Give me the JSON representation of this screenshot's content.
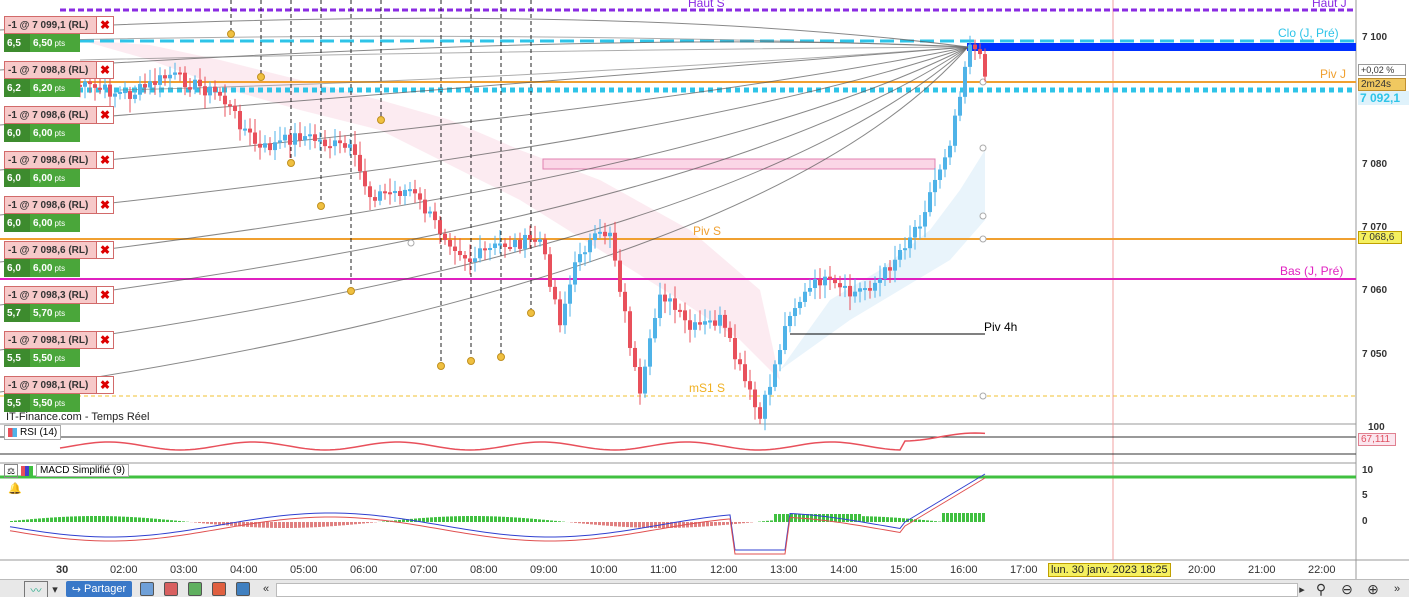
{
  "colors": {
    "up_candle": "#4fb3e8",
    "down_candle": "#e8505b",
    "clo_line": "#2ec4e8",
    "piv_line": "#f0a030",
    "bas_line": "#e020c0",
    "haut_line": "#8a2be2",
    "order_bg": "#f7c9c9",
    "pts_green": "#4aa63a"
  },
  "orders": [
    {
      "label": "-1 @ 7 099,1 (RL)",
      "qty": "6,5",
      "pts": "6,50",
      "unit": "pts"
    },
    {
      "label": "-1 @ 7 098,8 (RL)",
      "qty": "6,2",
      "pts": "6,20",
      "unit": "pts"
    },
    {
      "label": "-1 @ 7 098,6 (RL)",
      "qty": "6,0",
      "pts": "6,00",
      "unit": "pts"
    },
    {
      "label": "-1 @ 7 098,6 (RL)",
      "qty": "6,0",
      "pts": "6,00",
      "unit": "pts"
    },
    {
      "label": "-1 @ 7 098,6 (RL)",
      "qty": "6,0",
      "pts": "6,00",
      "unit": "pts"
    },
    {
      "label": "-1 @ 7 098,6 (RL)",
      "qty": "6,0",
      "pts": "6,00",
      "unit": "pts"
    },
    {
      "label": "-1 @ 7 098,3 (RL)",
      "qty": "5,7",
      "pts": "5,70",
      "unit": "pts"
    },
    {
      "label": "-1 @ 7 098,1 (RL)",
      "qty": "5,5",
      "pts": "5,50",
      "unit": "pts"
    },
    {
      "label": "-1 @ 7 098,1 (RL)",
      "qty": "5,5",
      "pts": "5,50",
      "unit": "pts"
    }
  ],
  "close_symbol": "✖",
  "levels": {
    "haut_s": "Haut S",
    "haut_j": "Haut J",
    "clo": "Clo (J, Pré)",
    "piv_j": "Piv J",
    "piv_s": "Piv S",
    "bas": "Bas (J, Pré)",
    "piv_4h": "Piv 4h",
    "ms1_s": "mS1 S"
  },
  "price_axis": [
    "7 100",
    "7 080",
    "7 070",
    "7 060",
    "7 050"
  ],
  "price_axis_cut": "100",
  "tags": {
    "change": "+0,02 %",
    "timer": "2m24s",
    "last_price": "7 092,1",
    "piv_s_value": "7 068,6",
    "rsi_value": "67,111"
  },
  "source": "IT-Finance.com - Temps Réel",
  "rsi": {
    "label": "RSI (14)"
  },
  "macd": {
    "label": "MACD Simplifié (9)",
    "axis": [
      "10",
      "5",
      "0"
    ]
  },
  "time_axis": {
    "day": "30",
    "ticks": [
      "02:00",
      "03:00",
      "04:00",
      "05:00",
      "06:00",
      "07:00",
      "08:00",
      "09:00",
      "10:00",
      "11:00",
      "12:00",
      "13:00",
      "14:00",
      "15:00",
      "16:00",
      "17:00",
      "20:00",
      "21:00",
      "22:00"
    ],
    "cursor_date": "lun. 30 janv. 2023 18:25"
  },
  "toolbar": {
    "share": "Partager"
  }
}
